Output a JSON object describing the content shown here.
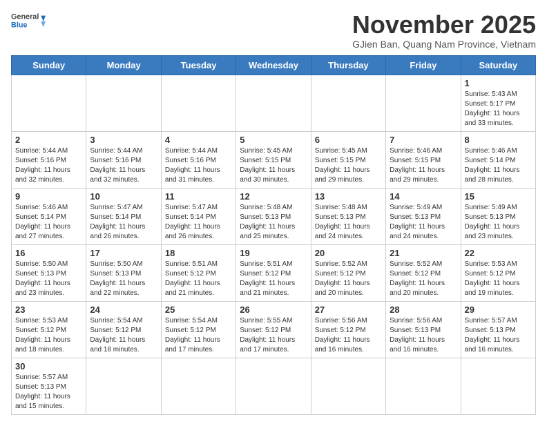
{
  "logo": {
    "general": "General",
    "blue": "Blue"
  },
  "header": {
    "month": "November 2025",
    "location": "GJien Ban, Quang Nam Province, Vietnam"
  },
  "days": [
    "Sunday",
    "Monday",
    "Tuesday",
    "Wednesday",
    "Thursday",
    "Friday",
    "Saturday"
  ],
  "weeks": [
    [
      {
        "day": "",
        "content": ""
      },
      {
        "day": "",
        "content": ""
      },
      {
        "day": "",
        "content": ""
      },
      {
        "day": "",
        "content": ""
      },
      {
        "day": "",
        "content": ""
      },
      {
        "day": "",
        "content": ""
      },
      {
        "day": "1",
        "content": "Sunrise: 5:43 AM\nSunset: 5:17 PM\nDaylight: 11 hours and 33 minutes."
      }
    ],
    [
      {
        "day": "2",
        "content": "Sunrise: 5:44 AM\nSunset: 5:16 PM\nDaylight: 11 hours and 32 minutes."
      },
      {
        "day": "3",
        "content": "Sunrise: 5:44 AM\nSunset: 5:16 PM\nDaylight: 11 hours and 32 minutes."
      },
      {
        "day": "4",
        "content": "Sunrise: 5:44 AM\nSunset: 5:16 PM\nDaylight: 11 hours and 31 minutes."
      },
      {
        "day": "5",
        "content": "Sunrise: 5:45 AM\nSunset: 5:15 PM\nDaylight: 11 hours and 30 minutes."
      },
      {
        "day": "6",
        "content": "Sunrise: 5:45 AM\nSunset: 5:15 PM\nDaylight: 11 hours and 29 minutes."
      },
      {
        "day": "7",
        "content": "Sunrise: 5:46 AM\nSunset: 5:15 PM\nDaylight: 11 hours and 29 minutes."
      },
      {
        "day": "8",
        "content": "Sunrise: 5:46 AM\nSunset: 5:14 PM\nDaylight: 11 hours and 28 minutes."
      }
    ],
    [
      {
        "day": "9",
        "content": "Sunrise: 5:46 AM\nSunset: 5:14 PM\nDaylight: 11 hours and 27 minutes."
      },
      {
        "day": "10",
        "content": "Sunrise: 5:47 AM\nSunset: 5:14 PM\nDaylight: 11 hours and 26 minutes."
      },
      {
        "day": "11",
        "content": "Sunrise: 5:47 AM\nSunset: 5:14 PM\nDaylight: 11 hours and 26 minutes."
      },
      {
        "day": "12",
        "content": "Sunrise: 5:48 AM\nSunset: 5:13 PM\nDaylight: 11 hours and 25 minutes."
      },
      {
        "day": "13",
        "content": "Sunrise: 5:48 AM\nSunset: 5:13 PM\nDaylight: 11 hours and 24 minutes."
      },
      {
        "day": "14",
        "content": "Sunrise: 5:49 AM\nSunset: 5:13 PM\nDaylight: 11 hours and 24 minutes."
      },
      {
        "day": "15",
        "content": "Sunrise: 5:49 AM\nSunset: 5:13 PM\nDaylight: 11 hours and 23 minutes."
      }
    ],
    [
      {
        "day": "16",
        "content": "Sunrise: 5:50 AM\nSunset: 5:13 PM\nDaylight: 11 hours and 23 minutes."
      },
      {
        "day": "17",
        "content": "Sunrise: 5:50 AM\nSunset: 5:13 PM\nDaylight: 11 hours and 22 minutes."
      },
      {
        "day": "18",
        "content": "Sunrise: 5:51 AM\nSunset: 5:12 PM\nDaylight: 11 hours and 21 minutes."
      },
      {
        "day": "19",
        "content": "Sunrise: 5:51 AM\nSunset: 5:12 PM\nDaylight: 11 hours and 21 minutes."
      },
      {
        "day": "20",
        "content": "Sunrise: 5:52 AM\nSunset: 5:12 PM\nDaylight: 11 hours and 20 minutes."
      },
      {
        "day": "21",
        "content": "Sunrise: 5:52 AM\nSunset: 5:12 PM\nDaylight: 11 hours and 20 minutes."
      },
      {
        "day": "22",
        "content": "Sunrise: 5:53 AM\nSunset: 5:12 PM\nDaylight: 11 hours and 19 minutes."
      }
    ],
    [
      {
        "day": "23",
        "content": "Sunrise: 5:53 AM\nSunset: 5:12 PM\nDaylight: 11 hours and 18 minutes."
      },
      {
        "day": "24",
        "content": "Sunrise: 5:54 AM\nSunset: 5:12 PM\nDaylight: 11 hours and 18 minutes."
      },
      {
        "day": "25",
        "content": "Sunrise: 5:54 AM\nSunset: 5:12 PM\nDaylight: 11 hours and 17 minutes."
      },
      {
        "day": "26",
        "content": "Sunrise: 5:55 AM\nSunset: 5:12 PM\nDaylight: 11 hours and 17 minutes."
      },
      {
        "day": "27",
        "content": "Sunrise: 5:56 AM\nSunset: 5:12 PM\nDaylight: 11 hours and 16 minutes."
      },
      {
        "day": "28",
        "content": "Sunrise: 5:56 AM\nSunset: 5:13 PM\nDaylight: 11 hours and 16 minutes."
      },
      {
        "day": "29",
        "content": "Sunrise: 5:57 AM\nSunset: 5:13 PM\nDaylight: 11 hours and 16 minutes."
      }
    ],
    [
      {
        "day": "30",
        "content": "Sunrise: 5:57 AM\nSunset: 5:13 PM\nDaylight: 11 hours and 15 minutes."
      },
      {
        "day": "",
        "content": ""
      },
      {
        "day": "",
        "content": ""
      },
      {
        "day": "",
        "content": ""
      },
      {
        "day": "",
        "content": ""
      },
      {
        "day": "",
        "content": ""
      },
      {
        "day": "",
        "content": ""
      }
    ]
  ]
}
